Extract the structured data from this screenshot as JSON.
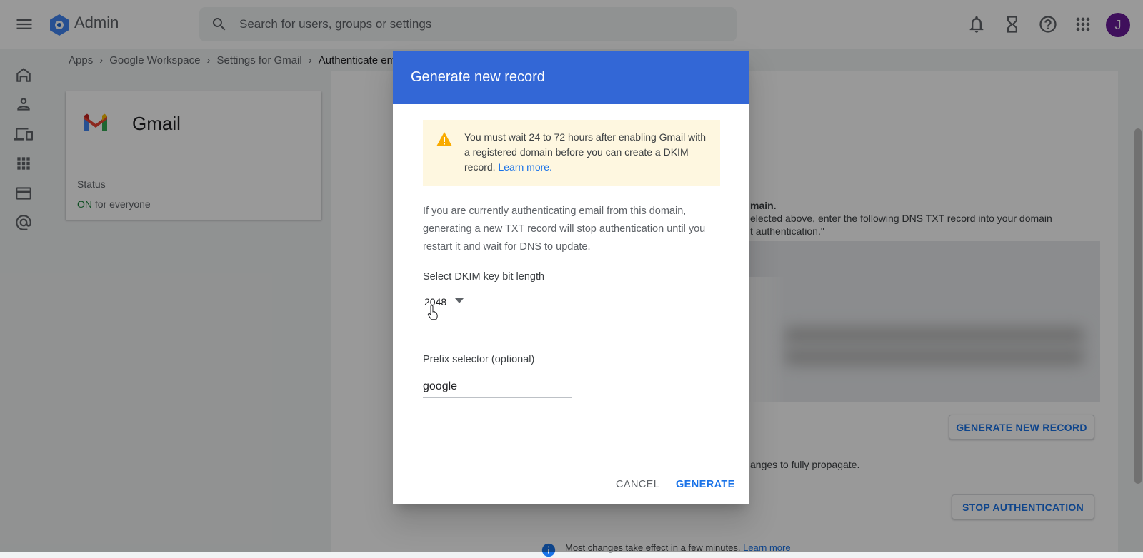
{
  "header": {
    "app_name": "Admin",
    "search_placeholder": "Search for users, groups or settings",
    "avatar_initial": "J"
  },
  "breadcrumb": {
    "items": [
      "Apps",
      "Google Workspace",
      "Settings for Gmail"
    ],
    "current": "Authenticate em"
  },
  "gmail_card": {
    "title": "Gmail",
    "status_label": "Status",
    "status_on": "ON",
    "status_suffix": " for everyone"
  },
  "main": {
    "text_domain": "main.",
    "text_instructions_1": "elected above, enter the following DNS TXT record into your domain",
    "text_instructions_2": "t authentication.\"",
    "generate_record_button": "GENERATE NEW RECORD",
    "propagate_text": "anges to fully propagate.",
    "stop_auth_button": "STOP AUTHENTICATION",
    "note_text": "Most changes take effect in a few minutes.",
    "note_link": "Learn more"
  },
  "dialog": {
    "title": "Generate new record",
    "warning_text": "You must wait 24 to 72 hours after enabling Gmail with a registered domain before you can create a DKIM record.",
    "warning_link": "Learn more.",
    "info_text": "If you are currently authenticating email from this domain, generating a new TXT record will stop authentication until you restart it and wait for DNS to update.",
    "bit_length_label": "Select DKIM key bit length",
    "bit_length_value": "2048",
    "prefix_label": "Prefix selector (optional)",
    "prefix_value": "google",
    "cancel_label": "CANCEL",
    "generate_label": "GENERATE"
  },
  "colors": {
    "dialog_header": "#3367d6",
    "primary": "#1a73e8",
    "status_on": "#188038",
    "warning_bg": "#fef7e0",
    "warning_icon": "#f9ab00",
    "avatar": "#6a1b9a"
  }
}
